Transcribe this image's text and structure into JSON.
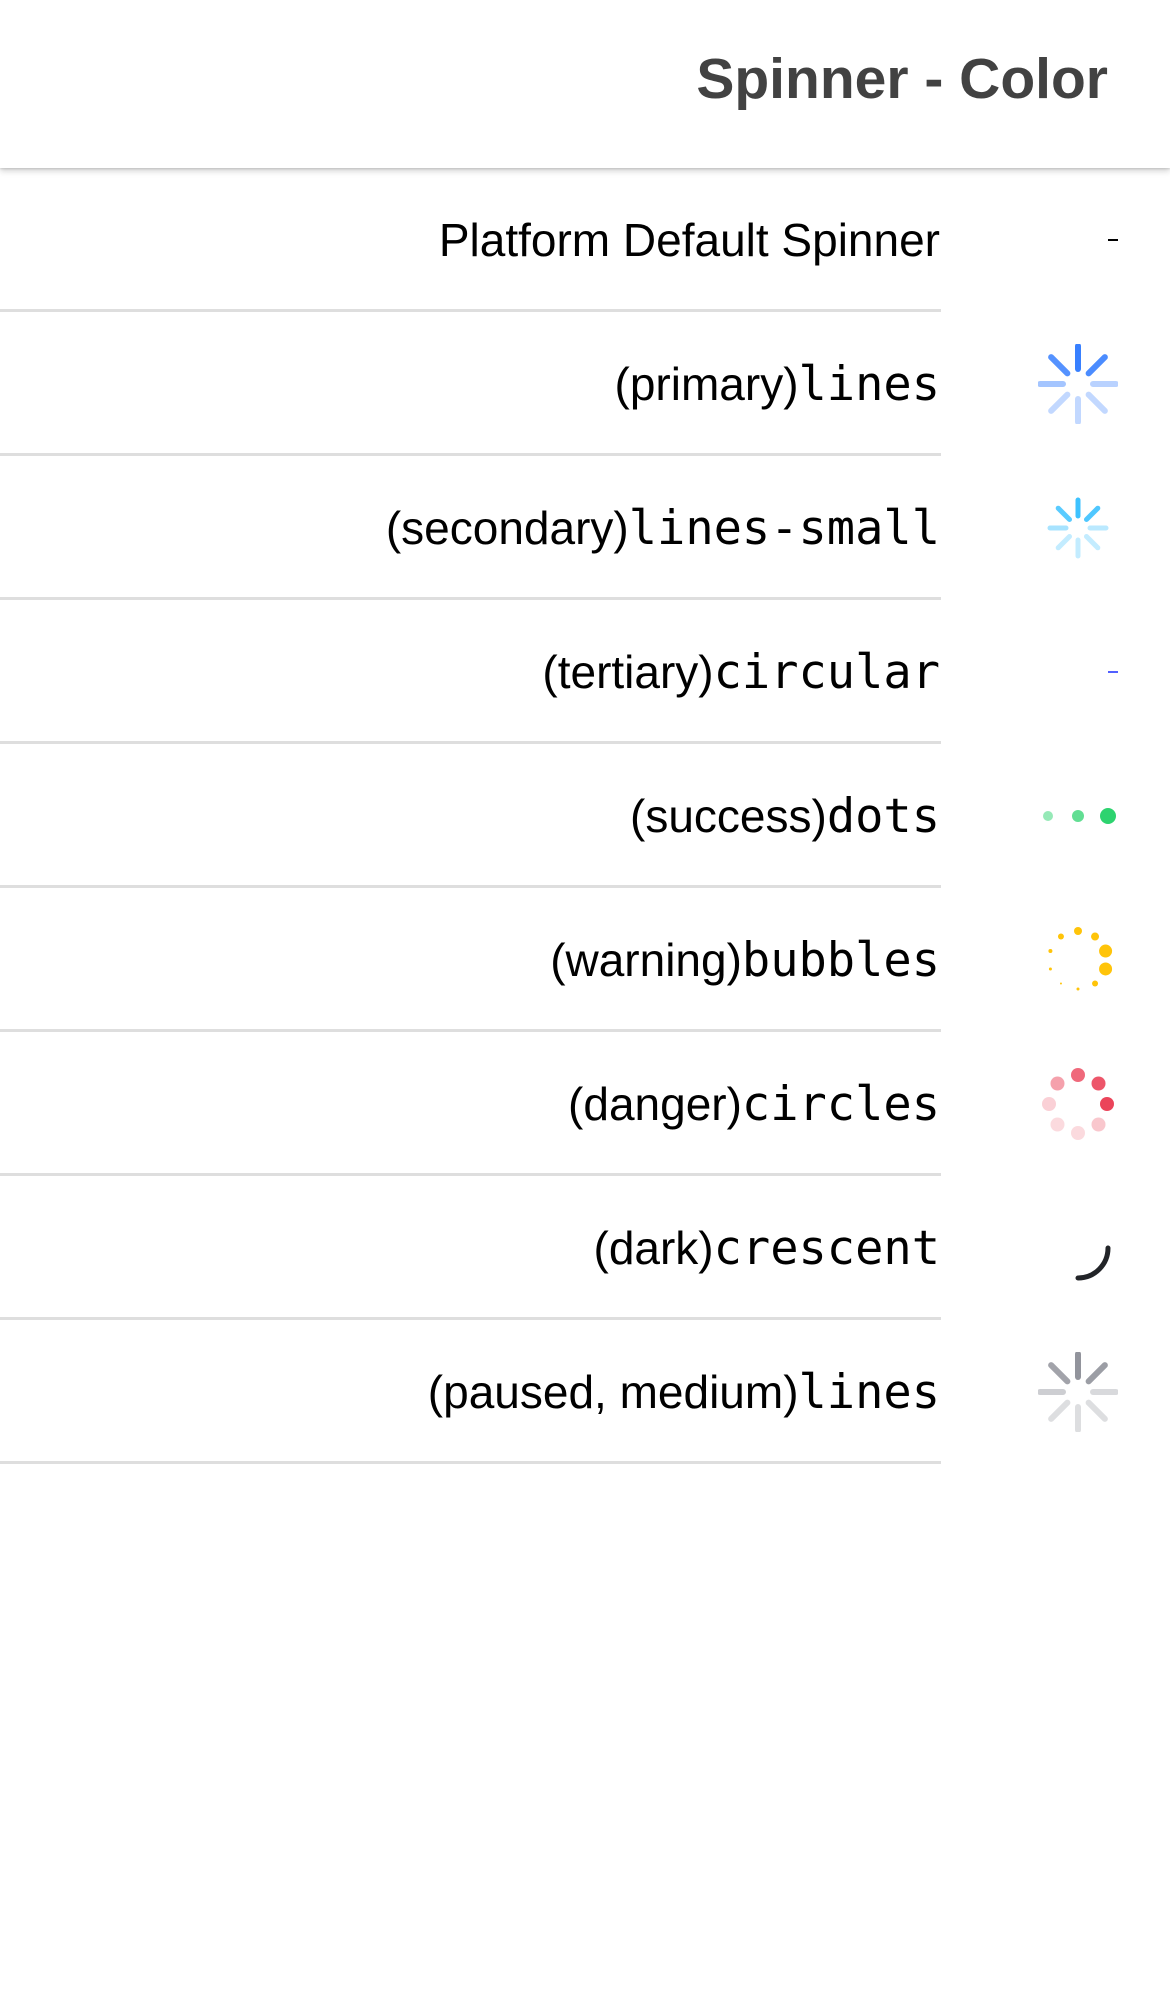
{
  "toolbar": {
    "title": "Spinner - Color"
  },
  "items": [
    {
      "label": "Platform Default Spinner",
      "color": null,
      "name": "",
      "spinner_icon": "platform-default-spinner-icon"
    },
    {
      "label": "(primary)",
      "name": "lines",
      "color": "#3880ff",
      "spinner_icon": "lines-spinner-icon"
    },
    {
      "label": "(secondary)",
      "name": "lines-small",
      "color": "#3dc2ff",
      "spinner_icon": "lines-small-spinner-icon"
    },
    {
      "label": "(tertiary)",
      "name": "circular",
      "color": "#5260ff",
      "spinner_icon": "circular-spinner-icon"
    },
    {
      "label": "(success)",
      "name": "dots",
      "color": "#2dd36f",
      "spinner_icon": "dots-spinner-icon"
    },
    {
      "label": "(warning)",
      "name": "bubbles",
      "color": "#ffc409",
      "spinner_icon": "bubbles-spinner-icon"
    },
    {
      "label": "(danger)",
      "name": "circles",
      "color": "#eb445a",
      "spinner_icon": "circles-spinner-icon"
    },
    {
      "label": "(dark)",
      "name": "crescent",
      "color": "#222428",
      "spinner_icon": "crescent-spinner-icon"
    },
    {
      "label": "(paused, medium)",
      "name": "lines",
      "color": "#92949c",
      "spinner_icon": "lines-spinner-icon"
    }
  ]
}
